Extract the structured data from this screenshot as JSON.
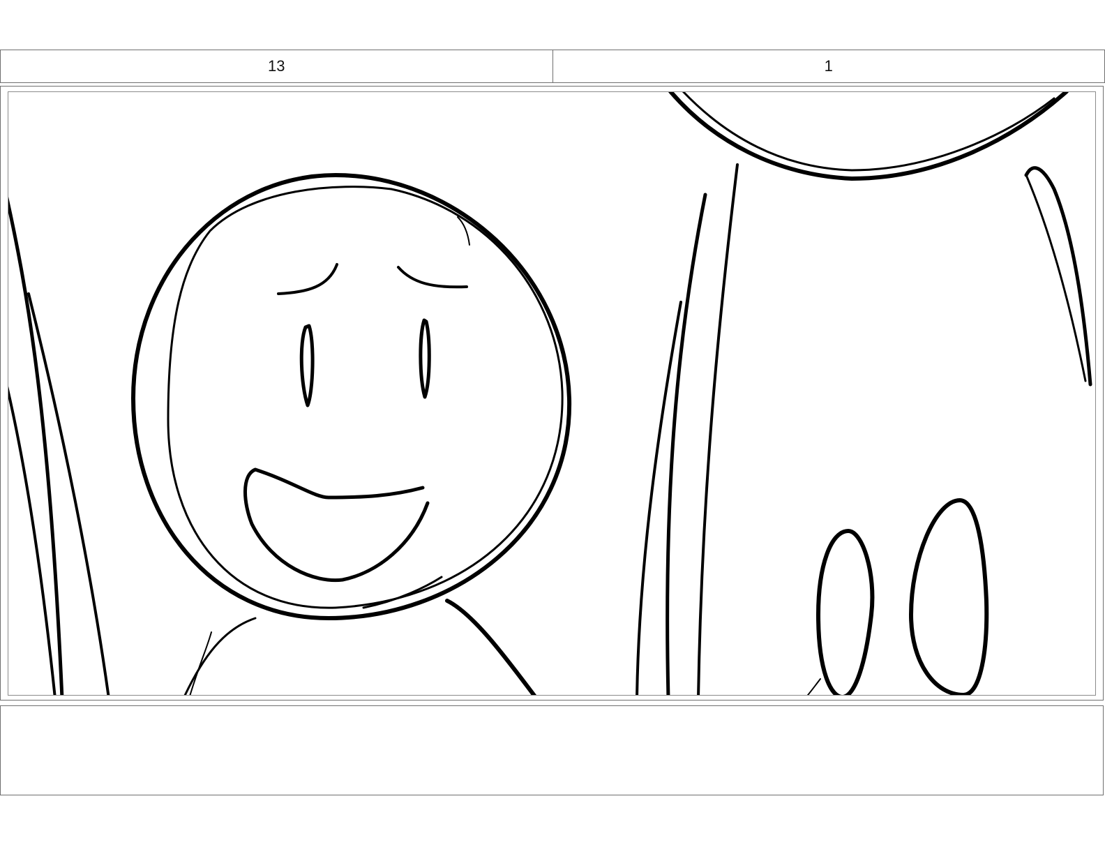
{
  "header": {
    "scene_number": "13",
    "panel_number": "1"
  },
  "panel": {
    "drawing": "storyboard-sketch"
  },
  "notes": {
    "text": ""
  }
}
